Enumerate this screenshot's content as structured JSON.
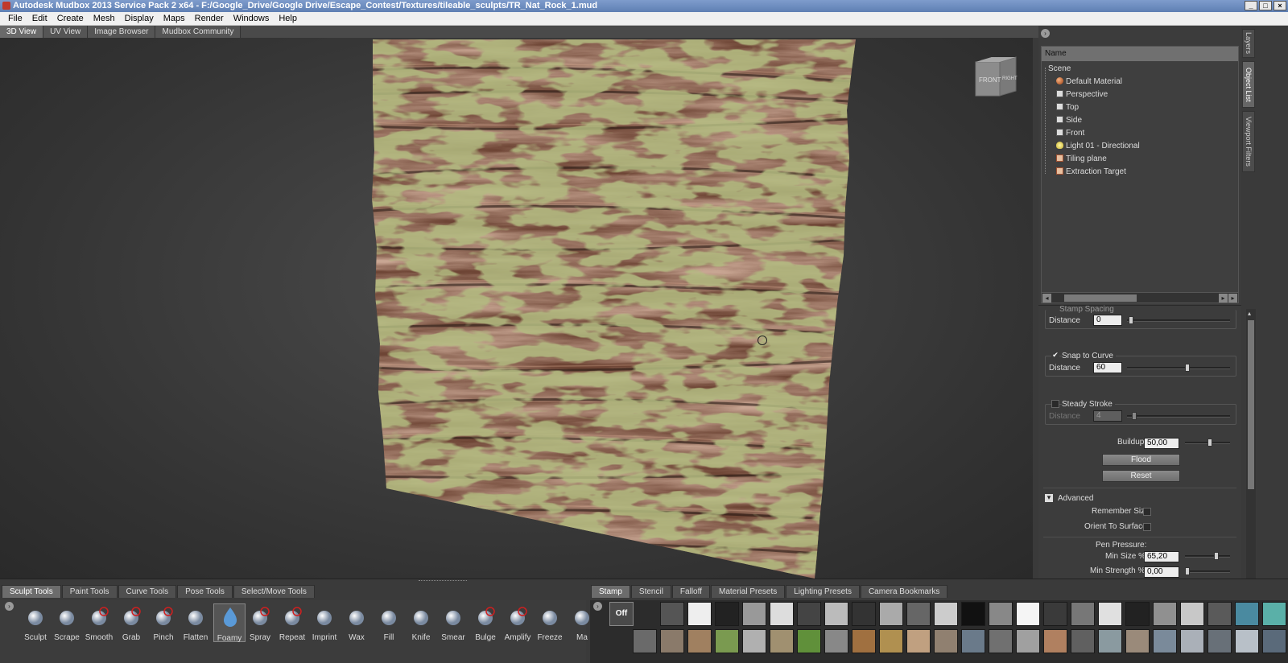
{
  "window": {
    "title": "Autodesk Mudbox 2013 Service Pack 2 x64 - F:/Google_Drive/Google Drive/Escape_Contest/Textures/tileable_sculpts/TR_Nat_Rock_1.mud",
    "minimize": "_",
    "maximize": "□",
    "close": "×"
  },
  "menu": [
    "File",
    "Edit",
    "Create",
    "Mesh",
    "Display",
    "Maps",
    "Render",
    "Windows",
    "Help"
  ],
  "view_tabs": [
    "3D View",
    "UV View",
    "Image Browser",
    "Mudbox Community"
  ],
  "viewcube": {
    "front": "FRONT",
    "right": "RIGHT"
  },
  "object_list": {
    "header": "Name",
    "items": [
      "Scene",
      "Default Material",
      "Perspective",
      "Top",
      "Side",
      "Front",
      "Light 01 - Directional",
      "Tiling plane",
      "Extraction Target"
    ]
  },
  "side_tabs": [
    "Layers",
    "Object List",
    "Viewport Filters"
  ],
  "properties": {
    "stamp_spacing_label": "Stamp Spacing",
    "stamp_spacing_distance_label": "Distance",
    "stamp_spacing_distance": "0",
    "snap_to_curve_label": "Snap to Curve",
    "snap_distance_label": "Distance",
    "snap_distance": "60",
    "steady_stroke_label": "Steady Stroke",
    "steady_distance_label": "Distance",
    "steady_distance": "4",
    "buildup_label": "Buildup",
    "buildup": "50,00",
    "flood_label": "Flood",
    "reset_label": "Reset",
    "advanced_label": "Advanced",
    "remember_size_label": "Remember Size",
    "orient_to_surface_label": "Orient To Surface",
    "pen_pressure_label": "Pen Pressure:",
    "min_size_label": "Min Size %",
    "min_size": "65,20",
    "min_strength_label": "Min Strength %",
    "min_strength": "0,00"
  },
  "tool_tabs": [
    "Sculpt Tools",
    "Paint Tools",
    "Curve Tools",
    "Pose Tools",
    "Select/Move Tools"
  ],
  "tools": [
    "Sculpt",
    "Scrape",
    "Smooth",
    "Grab",
    "Pinch",
    "Flatten",
    "Foamy",
    "Spray",
    "Repeat",
    "Imprint",
    "Wax",
    "Fill",
    "Knife",
    "Smear",
    "Bulge",
    "Amplify",
    "Freeze",
    "Ma"
  ],
  "selected_tool": "Foamy",
  "stamp_tabs": [
    "Stamp",
    "Stencil",
    "Falloff",
    "Material Presets",
    "Lighting Presets",
    "Camera Bookmarks"
  ],
  "stamp_off_label": "Off",
  "colors": {
    "accent_tool": "#5a8fd6",
    "titlebar": "#6f8fc2",
    "rock_base": "#8a5a44",
    "moss": "#7a8a3a"
  }
}
